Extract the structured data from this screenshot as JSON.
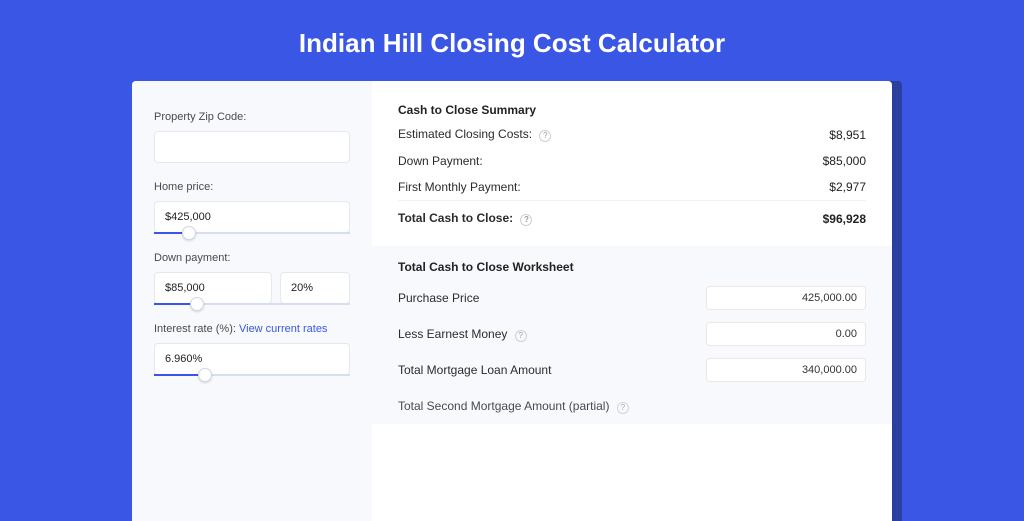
{
  "header": {
    "title": "Indian Hill Closing Cost Calculator"
  },
  "left": {
    "zip_label": "Property Zip Code:",
    "zip_value": "",
    "home_price_label": "Home price:",
    "home_price_value": "$425,000",
    "home_price_slider_pct": 18,
    "down_payment_label": "Down payment:",
    "down_payment_value": "$85,000",
    "down_payment_pct": "20%",
    "down_payment_slider_pct": 22,
    "interest_rate_label": "Interest rate (%):",
    "interest_rate_link": "View current rates",
    "interest_rate_value": "6.960%",
    "interest_rate_slider_pct": 26
  },
  "summary": {
    "title": "Cash to Close Summary",
    "rows": [
      {
        "label": "Estimated Closing Costs:",
        "help": true,
        "value": "$8,951"
      },
      {
        "label": "Down Payment:",
        "help": false,
        "value": "$85,000"
      },
      {
        "label": "First Monthly Payment:",
        "help": false,
        "value": "$2,977"
      }
    ],
    "total_label": "Total Cash to Close:",
    "total_help": true,
    "total_value": "$96,928"
  },
  "worksheet": {
    "title": "Total Cash to Close Worksheet",
    "rows": [
      {
        "label": "Purchase Price",
        "help": false,
        "value": "425,000.00"
      },
      {
        "label": "Less Earnest Money",
        "help": true,
        "value": "0.00"
      },
      {
        "label": "Total Mortgage Loan Amount",
        "help": false,
        "value": "340,000.00"
      },
      {
        "label": "Total Second Mortgage Amount (partial)",
        "help": true,
        "value": ""
      }
    ]
  },
  "icons": {
    "help_glyph": "?"
  }
}
